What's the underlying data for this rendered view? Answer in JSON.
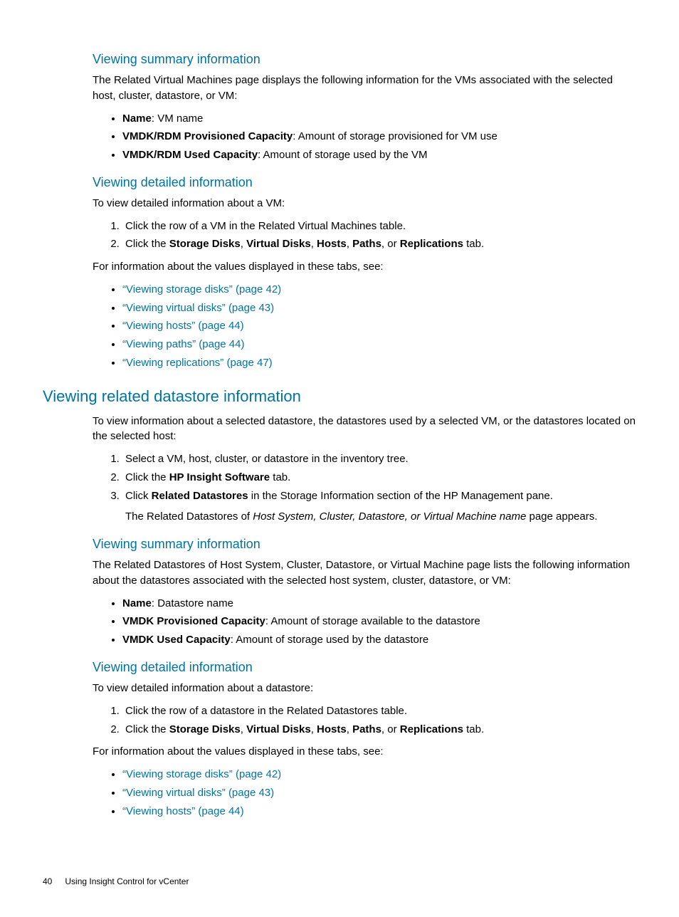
{
  "vm_summary": {
    "heading": "Viewing summary information",
    "intro": "The Related Virtual Machines page displays the following information for the VMs associated with the selected host, cluster, datastore, or VM:",
    "items": [
      {
        "term": "Name",
        "desc": ": VM name"
      },
      {
        "term": "VMDK/RDM Provisioned Capacity",
        "desc": ": Amount of storage provisioned for VM use"
      },
      {
        "term": "VMDK/RDM Used Capacity",
        "desc": ": Amount of storage used by the VM"
      }
    ]
  },
  "vm_detail": {
    "heading": "Viewing detailed information",
    "intro": "To view detailed information about a VM:",
    "steps": {
      "s1": "Click the row of a VM in the Related Virtual Machines table.",
      "s2_pre": "Click the ",
      "s2_b1": "Storage Disks",
      "s2_c1": ", ",
      "s2_b2": "Virtual Disks",
      "s2_c2": ", ",
      "s2_b3": "Hosts",
      "s2_c3": ", ",
      "s2_b4": "Paths",
      "s2_c4": ", or ",
      "s2_b5": "Replications",
      "s2_post": " tab."
    },
    "see_also_intro": "For information about the values displayed in these tabs, see:",
    "links": [
      "“Viewing storage disks” (page 42)",
      "“Viewing virtual disks” (page 43)",
      "“Viewing hosts” (page 44)",
      "“Viewing paths” (page 44)",
      "“Viewing replications” (page 47)"
    ]
  },
  "ds_section": {
    "heading": "Viewing related datastore information",
    "intro": "To view information about a selected datastore, the datastores used by a selected VM, or the datastores located on the selected host:",
    "steps": {
      "s1": "Select a VM, host, cluster, or datastore in the inventory tree.",
      "s2_pre": "Click the ",
      "s2_b": "HP Insight Software",
      "s2_post": " tab.",
      "s3_pre": "Click ",
      "s3_b": "Related Datastores",
      "s3_post": " in the Storage Information section of the HP Management pane.",
      "s3_sub_pre": "The Related Datastores of ",
      "s3_sub_em": "Host System, Cluster, Datastore, or Virtual Machine name",
      "s3_sub_post": " page appears."
    }
  },
  "ds_summary": {
    "heading": "Viewing summary information",
    "intro": "The Related Datastores of Host System, Cluster, Datastore, or Virtual Machine page lists the following information about the datastores associated with the selected host system, cluster, datastore, or VM:",
    "items": [
      {
        "term": "Name",
        "desc": ": Datastore name"
      },
      {
        "term": "VMDK Provisioned Capacity",
        "desc": ": Amount of storage available to the datastore"
      },
      {
        "term": "VMDK Used Capacity",
        "desc": ": Amount of storage used by the datastore"
      }
    ]
  },
  "ds_detail": {
    "heading": "Viewing detailed information",
    "intro": "To view detailed information about a datastore:",
    "steps": {
      "s1": "Click the row of a datastore in the Related Datastores table.",
      "s2_pre": "Click the ",
      "s2_b1": "Storage Disks",
      "s2_c1": ", ",
      "s2_b2": "Virtual Disks",
      "s2_c2": ", ",
      "s2_b3": "Hosts",
      "s2_c3": ", ",
      "s2_b4": "Paths",
      "s2_c4": ", or ",
      "s2_b5": "Replications",
      "s2_post": " tab."
    },
    "see_also_intro": "For information about the values displayed in these tabs, see:",
    "links": [
      "“Viewing storage disks” (page 42)",
      "“Viewing virtual disks” (page 43)",
      "“Viewing hosts” (page 44)"
    ]
  },
  "footer": {
    "page": "40",
    "running": "Using Insight Control for vCenter"
  }
}
